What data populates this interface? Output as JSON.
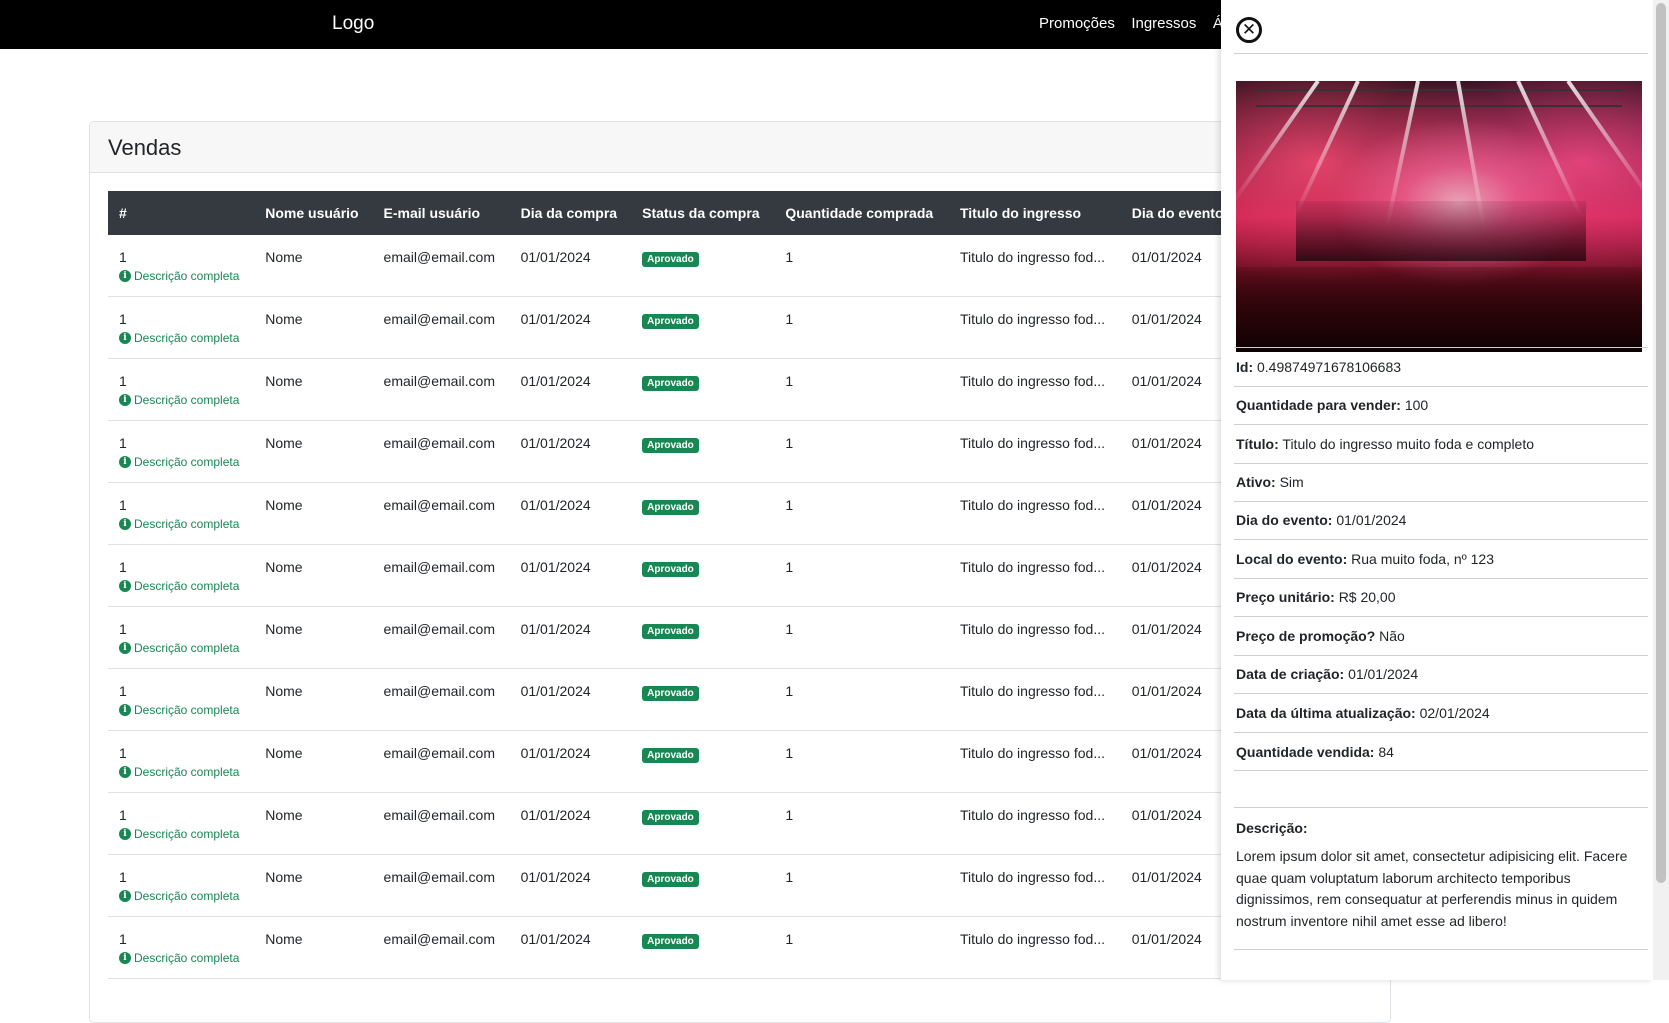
{
  "navbar": {
    "logo": "Logo",
    "links": [
      "Promoções",
      "Ingressos",
      "Áre"
    ]
  },
  "card": {
    "title": "Vendas"
  },
  "table": {
    "columns": [
      "#",
      "Nome usuário",
      "E-mail usuário",
      "Dia da compra",
      "Status da compra",
      "Quantidade comprada",
      "Titulo do ingresso",
      "Dia do evento"
    ],
    "desc_link_label": "Descrição completa",
    "rows": [
      {
        "id": "1",
        "nome": "Nome",
        "email": "email@email.com",
        "dia_compra": "01/01/2024",
        "status": "Aprovado",
        "quantidade": "1",
        "titulo": "Titulo do ingresso fod...",
        "dia_evento": "01/01/2024"
      },
      {
        "id": "1",
        "nome": "Nome",
        "email": "email@email.com",
        "dia_compra": "01/01/2024",
        "status": "Aprovado",
        "quantidade": "1",
        "titulo": "Titulo do ingresso fod...",
        "dia_evento": "01/01/2024"
      },
      {
        "id": "1",
        "nome": "Nome",
        "email": "email@email.com",
        "dia_compra": "01/01/2024",
        "status": "Aprovado",
        "quantidade": "1",
        "titulo": "Titulo do ingresso fod...",
        "dia_evento": "01/01/2024"
      },
      {
        "id": "1",
        "nome": "Nome",
        "email": "email@email.com",
        "dia_compra": "01/01/2024",
        "status": "Aprovado",
        "quantidade": "1",
        "titulo": "Titulo do ingresso fod...",
        "dia_evento": "01/01/2024"
      },
      {
        "id": "1",
        "nome": "Nome",
        "email": "email@email.com",
        "dia_compra": "01/01/2024",
        "status": "Aprovado",
        "quantidade": "1",
        "titulo": "Titulo do ingresso fod...",
        "dia_evento": "01/01/2024"
      },
      {
        "id": "1",
        "nome": "Nome",
        "email": "email@email.com",
        "dia_compra": "01/01/2024",
        "status": "Aprovado",
        "quantidade": "1",
        "titulo": "Titulo do ingresso fod...",
        "dia_evento": "01/01/2024"
      },
      {
        "id": "1",
        "nome": "Nome",
        "email": "email@email.com",
        "dia_compra": "01/01/2024",
        "status": "Aprovado",
        "quantidade": "1",
        "titulo": "Titulo do ingresso fod...",
        "dia_evento": "01/01/2024"
      },
      {
        "id": "1",
        "nome": "Nome",
        "email": "email@email.com",
        "dia_compra": "01/01/2024",
        "status": "Aprovado",
        "quantidade": "1",
        "titulo": "Titulo do ingresso fod...",
        "dia_evento": "01/01/2024"
      },
      {
        "id": "1",
        "nome": "Nome",
        "email": "email@email.com",
        "dia_compra": "01/01/2024",
        "status": "Aprovado",
        "quantidade": "1",
        "titulo": "Titulo do ingresso fod...",
        "dia_evento": "01/01/2024"
      },
      {
        "id": "1",
        "nome": "Nome",
        "email": "email@email.com",
        "dia_compra": "01/01/2024",
        "status": "Aprovado",
        "quantidade": "1",
        "titulo": "Titulo do ingresso fod...",
        "dia_evento": "01/01/2024"
      },
      {
        "id": "1",
        "nome": "Nome",
        "email": "email@email.com",
        "dia_compra": "01/01/2024",
        "status": "Aprovado",
        "quantidade": "1",
        "titulo": "Titulo do ingresso fod...",
        "dia_evento": "01/01/2024"
      },
      {
        "id": "1",
        "nome": "Nome",
        "email": "email@email.com",
        "dia_compra": "01/01/2024",
        "status": "Aprovado",
        "quantidade": "1",
        "titulo": "Titulo do ingresso fod...",
        "dia_evento": "01/01/2024"
      }
    ]
  },
  "panel": {
    "close_icon": "close-circle-icon",
    "image": "concert-stage-image",
    "fields": [
      {
        "label": "Id:",
        "value": "0.49874971678106683"
      },
      {
        "label": "Quantidade para vender:",
        "value": "100"
      },
      {
        "label": "Título:",
        "value": "Titulo do ingresso muito foda e completo"
      },
      {
        "label": "Ativo:",
        "value": "Sim"
      },
      {
        "label": "Dia do evento:",
        "value": "01/01/2024"
      },
      {
        "label": "Local do evento:",
        "value": "Rua muito foda, nº 123"
      },
      {
        "label": "Preço unitário:",
        "value": "R$ 20,00"
      },
      {
        "label": "Preço de promoção?",
        "value": "Não"
      },
      {
        "label": "Data de criação:",
        "value": "01/01/2024"
      },
      {
        "label": "Data da última atualização:",
        "value": "02/01/2024"
      },
      {
        "label": "Quantidade vendida:",
        "value": "84"
      }
    ],
    "description_label": "Descrição:",
    "description_text": "Lorem ipsum dolor sit amet, consectetur adipisicing elit. Facere quae quam voluptatum laborum architecto temporibus dignissimos, rem consequatur at perferendis minus in quidem nostrum inventore nihil amet esse ad libero!"
  },
  "colors": {
    "navbar_bg": "#000000",
    "table_header_bg": "#343a40",
    "success": "#198754"
  }
}
